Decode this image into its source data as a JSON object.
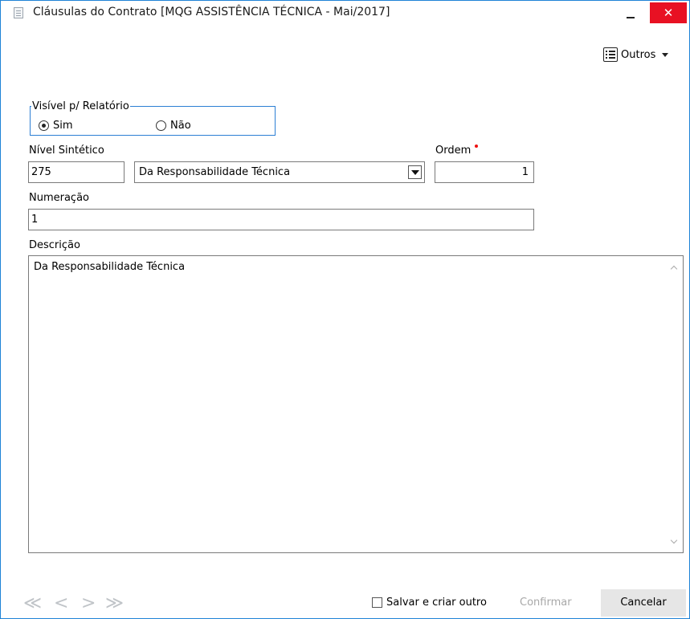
{
  "window": {
    "title": "Cláusulas do Contrato [MQG ASSISTÊNCIA TÉCNICA - Mai/2017]",
    "minimize_label": "_",
    "close_label": "✕"
  },
  "toolbar": {
    "outros_label": "Outros"
  },
  "visibility_group": {
    "legend": "Visível p/ Relatório",
    "option_yes": "Sim",
    "option_no": "Não",
    "selected": "Sim"
  },
  "fields": {
    "nivel_label": "Nível Sintético",
    "nivel_value": "275",
    "nivel_select_value": "Da Responsabilidade Técnica",
    "ordem_label": "Ordem",
    "ordem_value": "1",
    "numeracao_label": "Numeração",
    "numeracao_value": "1",
    "descricao_label": "Descrição",
    "descricao_value": "Da Responsabilidade Técnica"
  },
  "footer": {
    "nav_first": "≪",
    "nav_prev": "<",
    "nav_next": ">",
    "nav_last": "≫",
    "save_and_new_label": "Salvar e criar outro",
    "confirm_label": "Confirmar",
    "cancel_label": "Cancelar"
  },
  "colors": {
    "close_button": "#e81123",
    "group_border": "#2c7fd4",
    "required_marker": "#e11111"
  }
}
